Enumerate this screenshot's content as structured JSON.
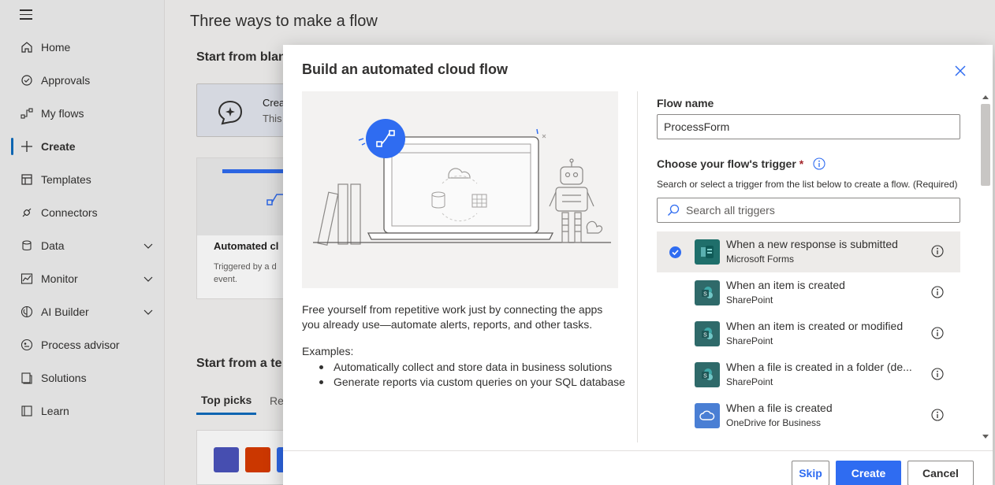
{
  "sidebar": {
    "items": [
      {
        "label": "Home",
        "icon": "home-icon"
      },
      {
        "label": "Approvals",
        "icon": "approvals-icon"
      },
      {
        "label": "My flows",
        "icon": "flows-icon"
      },
      {
        "label": "Create",
        "icon": "plus-icon",
        "active": true
      },
      {
        "label": "Templates",
        "icon": "templates-icon"
      },
      {
        "label": "Connectors",
        "icon": "connectors-icon"
      },
      {
        "label": "Data",
        "icon": "data-icon",
        "expandable": true
      },
      {
        "label": "Monitor",
        "icon": "monitor-icon",
        "expandable": true
      },
      {
        "label": "AI Builder",
        "icon": "ai-builder-icon",
        "expandable": true
      },
      {
        "label": "Process advisor",
        "icon": "process-advisor-icon"
      },
      {
        "label": "Solutions",
        "icon": "solutions-icon"
      },
      {
        "label": "Learn",
        "icon": "learn-icon"
      }
    ]
  },
  "background": {
    "title": "Three ways to make a flow",
    "start_blank": "Start from blan",
    "instant_card": {
      "line1": "Crea",
      "line2": "This"
    },
    "auto_card": {
      "title": "Automated cl",
      "desc": "Triggered by a d event."
    },
    "start_template": "Start from a te",
    "tabs": [
      "Top picks",
      "Re"
    ]
  },
  "dialog": {
    "title": "Build an automated cloud flow",
    "description": "Free yourself from repetitive work just by connecting the apps you already use—automate alerts, reports, and other tasks.",
    "examples_label": "Examples:",
    "examples": [
      "Automatically collect and store data in business solutions",
      "Generate reports via custom queries on your SQL database"
    ],
    "flow_name_label": "Flow name",
    "flow_name_value": "ProcessForm",
    "trigger_label": "Choose your flow's trigger",
    "required_mark": "*",
    "trigger_hint": "Search or select a trigger from the list below to create a flow. (Required)",
    "search_placeholder": "Search all triggers",
    "triggers": [
      {
        "name": "When a new response is submitted",
        "connector": "Microsoft Forms",
        "selected": true,
        "color": "#1f6f6b"
      },
      {
        "name": "When an item is created",
        "connector": "SharePoint",
        "selected": false,
        "color": "#2f6a6a"
      },
      {
        "name": "When an item is created or modified",
        "connector": "SharePoint",
        "selected": false,
        "color": "#2f6a6a"
      },
      {
        "name": "When a file is created in a folder (de...",
        "connector": "SharePoint",
        "selected": false,
        "color": "#2f6a6a"
      },
      {
        "name": "When a file is created",
        "connector": "OneDrive for Business",
        "selected": false,
        "color": "#4a7fd4"
      }
    ],
    "buttons": {
      "skip": "Skip",
      "create": "Create",
      "cancel": "Cancel"
    }
  },
  "colors": {
    "accent": "#2f6cf1",
    "selected_row": "#edebe9"
  }
}
